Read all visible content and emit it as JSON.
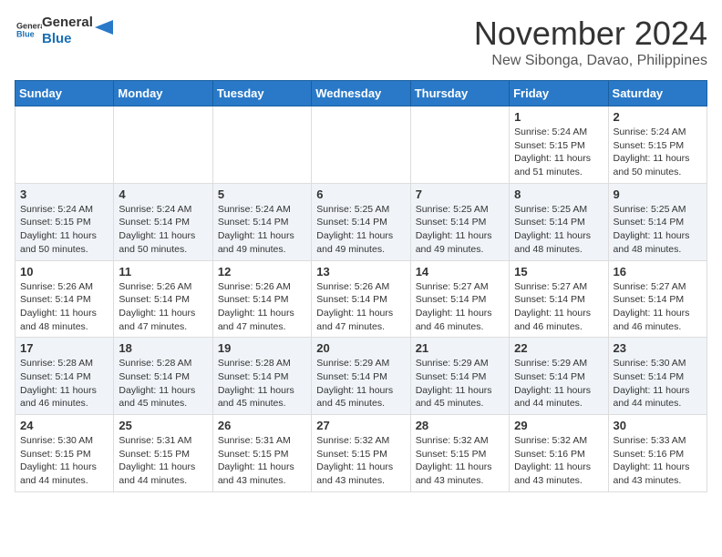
{
  "header": {
    "logo": {
      "line1": "General",
      "line2": "Blue"
    },
    "month": "November 2024",
    "location": "New Sibonga, Davao, Philippines"
  },
  "weekdays": [
    "Sunday",
    "Monday",
    "Tuesday",
    "Wednesday",
    "Thursday",
    "Friday",
    "Saturday"
  ],
  "weeks": [
    [
      {
        "day": "",
        "info": ""
      },
      {
        "day": "",
        "info": ""
      },
      {
        "day": "",
        "info": ""
      },
      {
        "day": "",
        "info": ""
      },
      {
        "day": "",
        "info": ""
      },
      {
        "day": "1",
        "info": "Sunrise: 5:24 AM\nSunset: 5:15 PM\nDaylight: 11 hours\nand 51 minutes."
      },
      {
        "day": "2",
        "info": "Sunrise: 5:24 AM\nSunset: 5:15 PM\nDaylight: 11 hours\nand 50 minutes."
      }
    ],
    [
      {
        "day": "3",
        "info": "Sunrise: 5:24 AM\nSunset: 5:15 PM\nDaylight: 11 hours\nand 50 minutes."
      },
      {
        "day": "4",
        "info": "Sunrise: 5:24 AM\nSunset: 5:14 PM\nDaylight: 11 hours\nand 50 minutes."
      },
      {
        "day": "5",
        "info": "Sunrise: 5:24 AM\nSunset: 5:14 PM\nDaylight: 11 hours\nand 49 minutes."
      },
      {
        "day": "6",
        "info": "Sunrise: 5:25 AM\nSunset: 5:14 PM\nDaylight: 11 hours\nand 49 minutes."
      },
      {
        "day": "7",
        "info": "Sunrise: 5:25 AM\nSunset: 5:14 PM\nDaylight: 11 hours\nand 49 minutes."
      },
      {
        "day": "8",
        "info": "Sunrise: 5:25 AM\nSunset: 5:14 PM\nDaylight: 11 hours\nand 48 minutes."
      },
      {
        "day": "9",
        "info": "Sunrise: 5:25 AM\nSunset: 5:14 PM\nDaylight: 11 hours\nand 48 minutes."
      }
    ],
    [
      {
        "day": "10",
        "info": "Sunrise: 5:26 AM\nSunset: 5:14 PM\nDaylight: 11 hours\nand 48 minutes."
      },
      {
        "day": "11",
        "info": "Sunrise: 5:26 AM\nSunset: 5:14 PM\nDaylight: 11 hours\nand 47 minutes."
      },
      {
        "day": "12",
        "info": "Sunrise: 5:26 AM\nSunset: 5:14 PM\nDaylight: 11 hours\nand 47 minutes."
      },
      {
        "day": "13",
        "info": "Sunrise: 5:26 AM\nSunset: 5:14 PM\nDaylight: 11 hours\nand 47 minutes."
      },
      {
        "day": "14",
        "info": "Sunrise: 5:27 AM\nSunset: 5:14 PM\nDaylight: 11 hours\nand 46 minutes."
      },
      {
        "day": "15",
        "info": "Sunrise: 5:27 AM\nSunset: 5:14 PM\nDaylight: 11 hours\nand 46 minutes."
      },
      {
        "day": "16",
        "info": "Sunrise: 5:27 AM\nSunset: 5:14 PM\nDaylight: 11 hours\nand 46 minutes."
      }
    ],
    [
      {
        "day": "17",
        "info": "Sunrise: 5:28 AM\nSunset: 5:14 PM\nDaylight: 11 hours\nand 46 minutes."
      },
      {
        "day": "18",
        "info": "Sunrise: 5:28 AM\nSunset: 5:14 PM\nDaylight: 11 hours\nand 45 minutes."
      },
      {
        "day": "19",
        "info": "Sunrise: 5:28 AM\nSunset: 5:14 PM\nDaylight: 11 hours\nand 45 minutes."
      },
      {
        "day": "20",
        "info": "Sunrise: 5:29 AM\nSunset: 5:14 PM\nDaylight: 11 hours\nand 45 minutes."
      },
      {
        "day": "21",
        "info": "Sunrise: 5:29 AM\nSunset: 5:14 PM\nDaylight: 11 hours\nand 45 minutes."
      },
      {
        "day": "22",
        "info": "Sunrise: 5:29 AM\nSunset: 5:14 PM\nDaylight: 11 hours\nand 44 minutes."
      },
      {
        "day": "23",
        "info": "Sunrise: 5:30 AM\nSunset: 5:14 PM\nDaylight: 11 hours\nand 44 minutes."
      }
    ],
    [
      {
        "day": "24",
        "info": "Sunrise: 5:30 AM\nSunset: 5:15 PM\nDaylight: 11 hours\nand 44 minutes."
      },
      {
        "day": "25",
        "info": "Sunrise: 5:31 AM\nSunset: 5:15 PM\nDaylight: 11 hours\nand 44 minutes."
      },
      {
        "day": "26",
        "info": "Sunrise: 5:31 AM\nSunset: 5:15 PM\nDaylight: 11 hours\nand 43 minutes."
      },
      {
        "day": "27",
        "info": "Sunrise: 5:32 AM\nSunset: 5:15 PM\nDaylight: 11 hours\nand 43 minutes."
      },
      {
        "day": "28",
        "info": "Sunrise: 5:32 AM\nSunset: 5:15 PM\nDaylight: 11 hours\nand 43 minutes."
      },
      {
        "day": "29",
        "info": "Sunrise: 5:32 AM\nSunset: 5:16 PM\nDaylight: 11 hours\nand 43 minutes."
      },
      {
        "day": "30",
        "info": "Sunrise: 5:33 AM\nSunset: 5:16 PM\nDaylight: 11 hours\nand 43 minutes."
      }
    ]
  ]
}
